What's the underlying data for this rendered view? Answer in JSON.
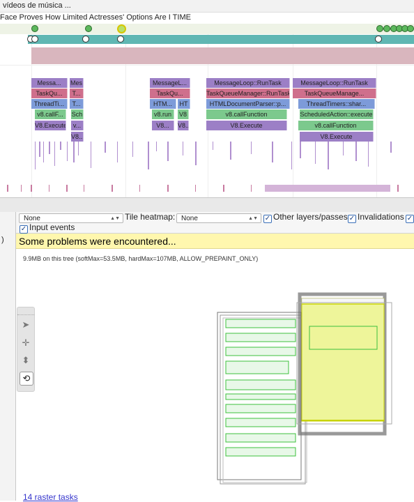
{
  "timeline": {
    "top_title": "vídeos de música ...",
    "frame_title": "Face Proves How Limited Actresses' Options Are I TIME",
    "rows": [
      {
        "labels": [
          "Messa...",
          "Mes",
          "MessageL...",
          "MessageLoop::RunTask",
          "MessageLoop::RunTask"
        ]
      },
      {
        "labels": [
          "TaskQu...",
          "T...",
          "TaskQu...",
          "TaskQueueManager::RunTask",
          "TaskQueueManage..."
        ]
      },
      {
        "labels": [
          "ThreadTi...",
          "T...",
          "HTM...",
          "HT",
          "HTMLDocumentParser::p...",
          "ThreadTimers::shar..."
        ]
      },
      {
        "labels": [
          "v8.callF...",
          "Sch",
          "v8.run",
          "V8",
          "v8.callFunction",
          "ScheduledAction::execute"
        ]
      },
      {
        "labels": [
          "V8.Execute",
          "v...",
          "V8...",
          "V8...",
          "V8.Execute",
          "v8.callFunction"
        ]
      },
      {
        "labels": [
          "V8...",
          "V8.Execute"
        ]
      }
    ]
  },
  "left_strip_text": ")",
  "toolbar": {
    "select1_value": "None",
    "tile_heatmap_label": "Tile heatmap:",
    "select2_value": "None",
    "other_layers_label": "Other layers/passes",
    "invalidations_label": "Invalidations",
    "input_events_label": "Input events",
    "checkbox_mark": "✓"
  },
  "warning": "Some problems were encountered...",
  "memory_text": "9.9MB on this tree (softMax=53.5MB, hardMax=107MB, ALLOW_PREPAINT_ONLY)",
  "raster_link": "14 raster tasks",
  "colors": {
    "purple": "#9c7fc6",
    "pink": "#cf6f8c",
    "blue": "#7d9bd9",
    "green": "#7cc98d",
    "teal": "#5fb7b3",
    "yellow_highlight": "#eef59a",
    "warning_bg": "#fff7ae"
  },
  "icons": [
    "pointer-icon",
    "pan-icon",
    "zoom-icon",
    "rotate-icon"
  ]
}
